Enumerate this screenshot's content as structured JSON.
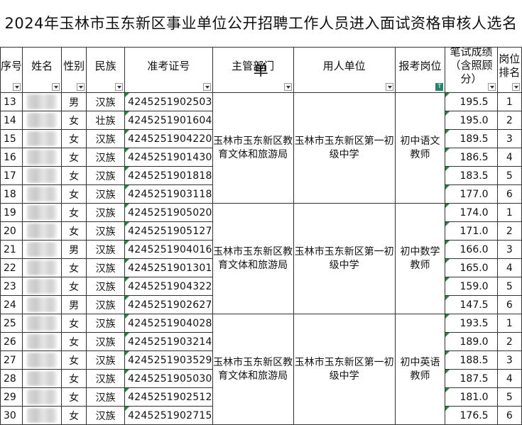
{
  "title": "2024年玉林市玉东新区事业单位公开招聘工作人员进入面试资格审核人选名单",
  "headers": [
    "序号",
    "姓名",
    "性别",
    "民族",
    "准考证号",
    "主管部门",
    "用人单位",
    "报考岗位",
    "笔试成绩（含照顾分）",
    "岗位排名"
  ],
  "groups": [
    {
      "department": "玉林市玉东新区教育文体和旅游局",
      "employer": "玉林市玉东新区第一初级中学",
      "position": "初中语文教师",
      "rows": [
        {
          "no": "13",
          "gender": "男",
          "ethnicity": "汉族",
          "exam_id": "4245251902503",
          "score": "195.5",
          "rank": "1"
        },
        {
          "no": "14",
          "gender": "女",
          "ethnicity": "壮族",
          "exam_id": "4245251901604",
          "score": "195.0",
          "rank": "2"
        },
        {
          "no": "15",
          "gender": "女",
          "ethnicity": "汉族",
          "exam_id": "4245251904220",
          "score": "189.5",
          "rank": "3"
        },
        {
          "no": "16",
          "gender": "女",
          "ethnicity": "汉族",
          "exam_id": "4245251901430",
          "score": "186.5",
          "rank": "4"
        },
        {
          "no": "17",
          "gender": "女",
          "ethnicity": "汉族",
          "exam_id": "4245251901818",
          "score": "183.5",
          "rank": "5"
        },
        {
          "no": "18",
          "gender": "女",
          "ethnicity": "汉族",
          "exam_id": "4245251903118",
          "score": "177.0",
          "rank": "6"
        }
      ]
    },
    {
      "department": "玉林市玉东新区教育文体和旅游局",
      "employer": "玉林市玉东新区第一初级中学",
      "position": "初中数学教师",
      "rows": [
        {
          "no": "19",
          "gender": "女",
          "ethnicity": "汉族",
          "exam_id": "4245251905020",
          "score": "174.0",
          "rank": "1"
        },
        {
          "no": "20",
          "gender": "女",
          "ethnicity": "汉族",
          "exam_id": "4245251905127",
          "score": "171.0",
          "rank": "2"
        },
        {
          "no": "21",
          "gender": "男",
          "ethnicity": "汉族",
          "exam_id": "4245251904016",
          "score": "166.0",
          "rank": "3"
        },
        {
          "no": "22",
          "gender": "女",
          "ethnicity": "汉族",
          "exam_id": "4245251901301",
          "score": "165.0",
          "rank": "4"
        },
        {
          "no": "23",
          "gender": "女",
          "ethnicity": "汉族",
          "exam_id": "4245251904322",
          "score": "159.0",
          "rank": "5"
        },
        {
          "no": "24",
          "gender": "男",
          "ethnicity": "汉族",
          "exam_id": "4245251902627",
          "score": "147.5",
          "rank": "6"
        }
      ]
    },
    {
      "department": "玉林市玉东新区教育文体和旅游局",
      "employer": "玉林市玉东新区第一初级中学",
      "position": "初中英语教师",
      "rows": [
        {
          "no": "25",
          "gender": "女",
          "ethnicity": "汉族",
          "exam_id": "4245251904028",
          "score": "193.5",
          "rank": "1"
        },
        {
          "no": "26",
          "gender": "女",
          "ethnicity": "汉族",
          "exam_id": "4245251903214",
          "score": "189.0",
          "rank": "2"
        },
        {
          "no": "27",
          "gender": "女",
          "ethnicity": "汉族",
          "exam_id": "4245251903529",
          "score": "188.5",
          "rank": "3"
        },
        {
          "no": "28",
          "gender": "女",
          "ethnicity": "汉族",
          "exam_id": "4245251905030",
          "score": "187.5",
          "rank": "4"
        },
        {
          "no": "29",
          "gender": "女",
          "ethnicity": "汉族",
          "exam_id": "4245251902512",
          "score": "181.0",
          "rank": "5"
        },
        {
          "no": "30",
          "gender": "女",
          "ethnicity": "汉族",
          "exam_id": "4245251902715",
          "score": "176.5",
          "rank": "6"
        }
      ]
    }
  ]
}
